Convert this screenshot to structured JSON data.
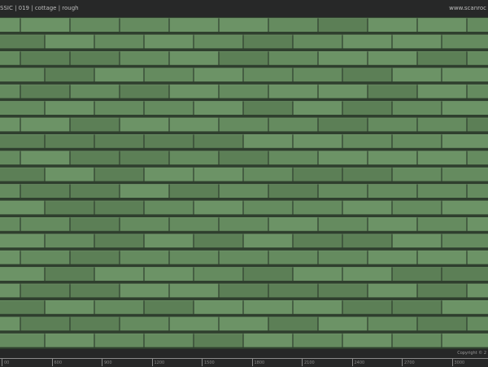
{
  "header": {
    "title": "SSIC | 019 | cottage | rough",
    "site": "www.scanroc"
  },
  "footer": {
    "copyright": "Copyright © 2",
    "ruler_labels": [
      "00",
      "600",
      "900",
      "1200",
      "1500",
      "1800",
      "2100",
      "2400",
      "2700",
      "3000"
    ]
  },
  "colors": {
    "tile_base": "#658b5f",
    "tile_light": "#6c9366",
    "tile_dark": "#5c7f56",
    "shadow": "#2f3f2e",
    "highlight": "#83a57b"
  }
}
